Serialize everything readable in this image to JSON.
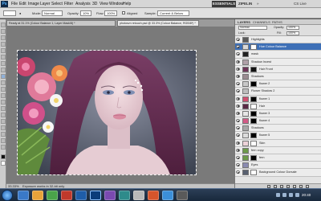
{
  "app": {
    "logo": "Ps"
  },
  "menus": [
    "File",
    "Edit",
    "Image",
    "Layer",
    "Select",
    "Filter",
    "Analysis",
    "3D",
    "View",
    "Window",
    "Help"
  ],
  "workspaces": {
    "active": "ESSENTIALS",
    "secondary": "ZIPELIN",
    "more": "»",
    "cs_live": "CS Live"
  },
  "options_bar": {
    "tool_preset": "",
    "mode_label": "Mode:",
    "mode_value": "Normal",
    "opacity_label": "Opacity:",
    "opacity_value": "10%",
    "flow_label": "Flow:",
    "flow_value": "100%",
    "sample_label": "Sample:",
    "sample_value": "Current & Below",
    "aligned_label": "Aligned"
  },
  "tabs": [
    {
      "label": "Ready at 31.1% (Colour Balance 1, Layer Mask/8) *"
    },
    {
      "label": "photosvn retouch.psd @ 33.3% (Colour Balance, RGB/8*) *"
    }
  ],
  "status": {
    "zoom": "33.33%",
    "doc": "Exposure works in 32-bit only"
  },
  "layers_panel": {
    "tabs": [
      "LAYERS",
      "CHANNELS",
      "PATHS"
    ],
    "blend_mode": "Normal",
    "opacity_label": "Opacity:",
    "opacity_value": "100%",
    "lock_label": "Lock:",
    "fill_label": "Fill:",
    "fill_value": "100%",
    "layers": [
      {
        "name": "Highlights",
        "thumb": "#5a5a5a",
        "mask": ""
      },
      {
        "name": "Hue Colour Balance",
        "thumb": "#d9d9d9",
        "mask": "#ffffff",
        "selected": true
      },
      {
        "name": "mask",
        "thumb": "#222222",
        "mask": ""
      },
      {
        "name": "Shadow Incest",
        "thumb": "#b0a0a8",
        "mask": ""
      },
      {
        "name": "Hair Front",
        "thumb": "#6e3558",
        "mask": "#111111"
      },
      {
        "name": "Shadows",
        "thumb": "#9a8a90",
        "mask": ""
      },
      {
        "name": "flower 2",
        "thumb": "#c8c8c8",
        "mask": "#000000"
      },
      {
        "name": "Flower Shadow 2",
        "thumb": "#bdbdbd",
        "mask": ""
      },
      {
        "name": "flower 1",
        "thumb": "#d05070",
        "mask": "#000000"
      },
      {
        "name": "Hair",
        "thumb": "#5b2945",
        "mask": "#ffffff"
      },
      {
        "name": "flower 3",
        "thumb": "#e6e6e6",
        "mask": "#000000"
      },
      {
        "name": "flower 4",
        "thumb": "#d35a86",
        "mask": "#000000"
      },
      {
        "name": "Shadows",
        "thumb": "#a7a7a7",
        "mask": ""
      },
      {
        "name": "flower 5",
        "thumb": "#dcdcdc",
        "mask": "#000000"
      },
      {
        "name": "Skin",
        "thumb": "#ecd2d8",
        "mask": "#ffffff"
      },
      {
        "name": "fern copy",
        "thumb": "#6d9a4a",
        "mask": ""
      },
      {
        "name": "fern",
        "thumb": "#6d9a4a",
        "mask": "#000000"
      },
      {
        "name": "Eyes",
        "thumb": "#8a8ab0",
        "mask": ""
      },
      {
        "name": "Background Colour Dorsale",
        "thumb": "#596070",
        "mask": "#ffffff"
      }
    ]
  },
  "taskbar": {
    "clock": "20:40"
  }
}
